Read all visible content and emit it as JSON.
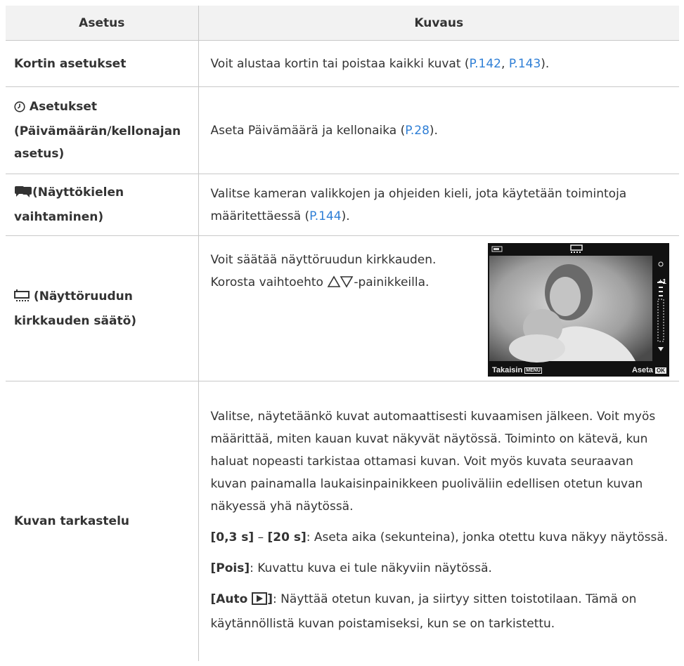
{
  "header": {
    "col_setting": "Asetus",
    "col_description": "Kuvaus"
  },
  "rows": {
    "r1": {
      "setting": "Kortin asetukset",
      "desc_pre": "Voit alustaa kortin tai poistaa kaikki kuvat (",
      "link1": "P.142",
      "sep": ", ",
      "link2": "P.143",
      "desc_post": ")."
    },
    "r2": {
      "setting_a": "Asetukset",
      "setting_b": "(Päivämäärän/kellonajan asetus)",
      "desc_pre": "Aseta Päivämäärä ja kellonaika (",
      "link": "P.28",
      "desc_post": ")."
    },
    "r3": {
      "setting": "(Näyttökielen vaihtaminen)",
      "desc_pre": "Valitse kameran valikkojen ja ohjeiden kieli, jota käytetään toimintoja määritettäessä (",
      "link": "P.144",
      "desc_post": ")."
    },
    "r4": {
      "setting": "(Näyttöruudun kirkkauden säätö)",
      "line1": "Voit säätää näyttöruudun kirkkauden.",
      "line2_pre": "Korosta vaihtoehto",
      "line2_post": "-painikkeilla.",
      "screen": {
        "back_label": "Takaisin",
        "back_key": "MENU",
        "set_label": "Aseta",
        "set_key": "OK",
        "level": "+1"
      }
    },
    "r5": {
      "setting": "Kuvan tarkastelu",
      "p1": "Valitse, näytetäänkö kuvat automaattisesti kuvaamisen jälkeen. Voit myös määrittää, miten kauan kuvat näkyvät näytössä. Toiminto on kätevä, kun haluat nopeasti tarkistaa ottamasi kuvan. Voit myös kuvata seuraavan kuvan painamalla laukaisinpainikkeen puoliväliin edellisen otetun kuvan näkyessä yhä näytössä.",
      "p2_a": "[0,3 s]",
      "p2_dash": " – ",
      "p2_b": "[20 s]",
      "p2_rest": ": Aseta aika (sekunteina), jonka otettu kuva näkyy näytössä.",
      "p3_a": "[Pois]",
      "p3_rest": ": Kuvattu kuva ei tule näkyviin näytössä.",
      "p4_a": "[Auto ",
      "p4_b": "]",
      "p4_rest": ": Näyttää otetun kuvan, ja siirtyy sitten toistotilaan. Tämä on käytännöllistä kuvan poistamiseksi, kun se on tarkistettu."
    }
  }
}
